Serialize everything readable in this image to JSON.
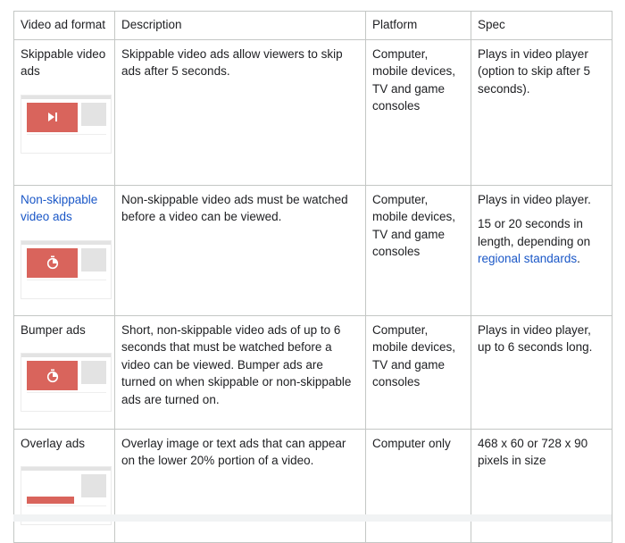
{
  "headers": [
    "Video ad format",
    "Description",
    "Platform",
    "Spec"
  ],
  "rows": [
    {
      "format": "Skippable video ads",
      "description": "Skippable video ads allow viewers to skip ads after 5 seconds.",
      "platform": "Computer, mobile devices, TV and game consoles",
      "spec": [
        "Plays in video player (option to skip after 5 seconds)."
      ],
      "thumbnail_icon": "skip-next-icon"
    },
    {
      "format": "Non-skippable video ads",
      "description": "Non-skippable video ads must be watched before a video can be viewed.",
      "platform": "Computer, mobile devices, TV and game consoles",
      "spec_line1": "Plays in video player.",
      "spec_line2_prefix": "15 or 20 seconds in length, depending on ",
      "spec_link": "regional standards",
      "spec_line2_suffix": ".",
      "thumbnail_icon": "timer-icon"
    },
    {
      "format": "Bumper ads",
      "description": "Short, non-skippable video ads of up to 6 seconds that must be watched before a video can be viewed. Bumper ads are turned on when skippable or non-skippable ads are turned on.",
      "platform": "Computer, mobile devices, TV and game consoles",
      "spec": [
        "Plays in video player, up to 6 seconds long."
      ],
      "thumbnail_icon": "timer-icon"
    },
    {
      "format": "Overlay ads",
      "description": "Overlay image or text ads that can appear on the lower 20% portion of a video.",
      "platform": "Computer only",
      "spec": [
        "468 x 60 or 728 x 90 pixels in size"
      ],
      "thumbnail_icon": "overlay-banner"
    }
  ],
  "colors": {
    "link": "#1a57c7",
    "thumb_accent": "#d9645c",
    "thumb_gray": "#e3e3e3",
    "border": "#c4c7c5"
  }
}
